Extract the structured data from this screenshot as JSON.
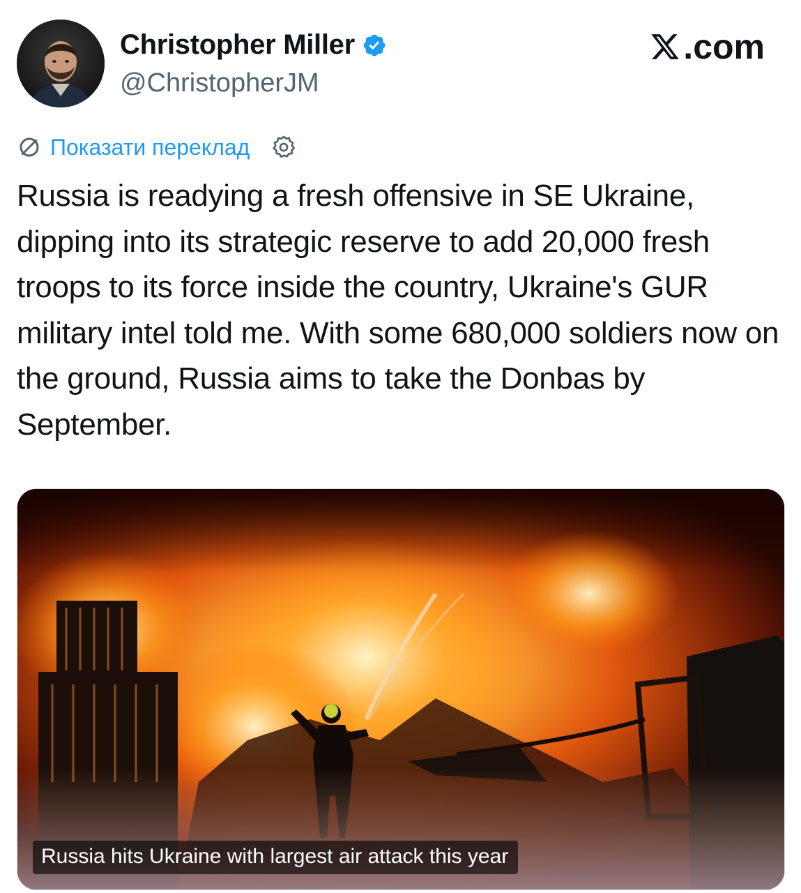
{
  "author": {
    "name": "Christopher Miller",
    "handle": "@ChristopherJM",
    "verified_icon": "verified-badge-icon",
    "avatar": "profile-photo"
  },
  "source": {
    "site": ".com",
    "logo_icon": "x-logo-icon"
  },
  "translate": {
    "label": "Показати переклад",
    "translate_icon": "translate-icon",
    "settings_icon": "gear-icon"
  },
  "tweet": {
    "text": "Russia is readying a fresh offensive in SE Ukraine, dipping into its strategic reserve to add 20,000 fresh troops to its force inside the country, Ukraine's GUR military intel told me. With some 680,000 soldiers now on the ground, Russia aims to take the Donbas by September."
  },
  "media": {
    "caption": "Russia hits Ukraine with largest air attack this year",
    "image": "firefighter-spraying-water-on-large-fire"
  },
  "colors": {
    "link": "#1d9bf0",
    "verified": "#1d9bf0",
    "handle": "#536471",
    "text": "#0f1419"
  }
}
